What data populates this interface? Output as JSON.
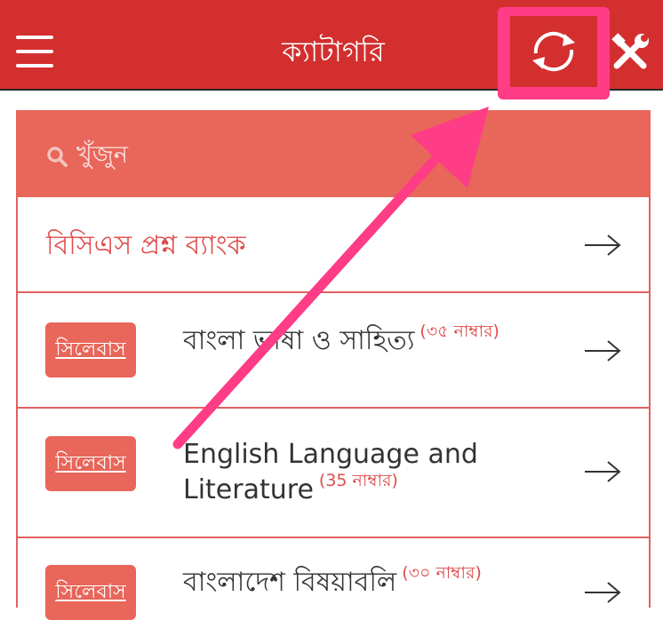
{
  "header": {
    "title": "ক্যাটাগরি",
    "menu_icon": "hamburger-menu-icon",
    "refresh_icon": "refresh-icon",
    "tools_icon": "tools-icon",
    "bar_color": "#d32f2f",
    "highlight_color": "#ff3c86"
  },
  "search": {
    "placeholder": "খুঁজুন",
    "icon": "search-icon",
    "bg_color": "#e8665a"
  },
  "question_bank": {
    "label": "বিসিএস প্রশ্ন ব্যাংক"
  },
  "subjects": [
    {
      "syllabus_label": "সিলেবাস",
      "name": "বাংলা ভাষা ও সাহিত্য",
      "marks": "(৩৫ নাম্বার)"
    },
    {
      "syllabus_label": "সিলেবাস",
      "name_line1": "English Language and",
      "name_line2": "Literature",
      "marks": "(35 নাম্বার)"
    },
    {
      "syllabus_label": "সিলেবাস",
      "name": "বাংলাদেশ বিষয়াবলি",
      "marks": "(৩০ নাম্বার)"
    }
  ],
  "annotation": {
    "icon": "callout-arrow-icon",
    "color": "#ff3c86"
  }
}
